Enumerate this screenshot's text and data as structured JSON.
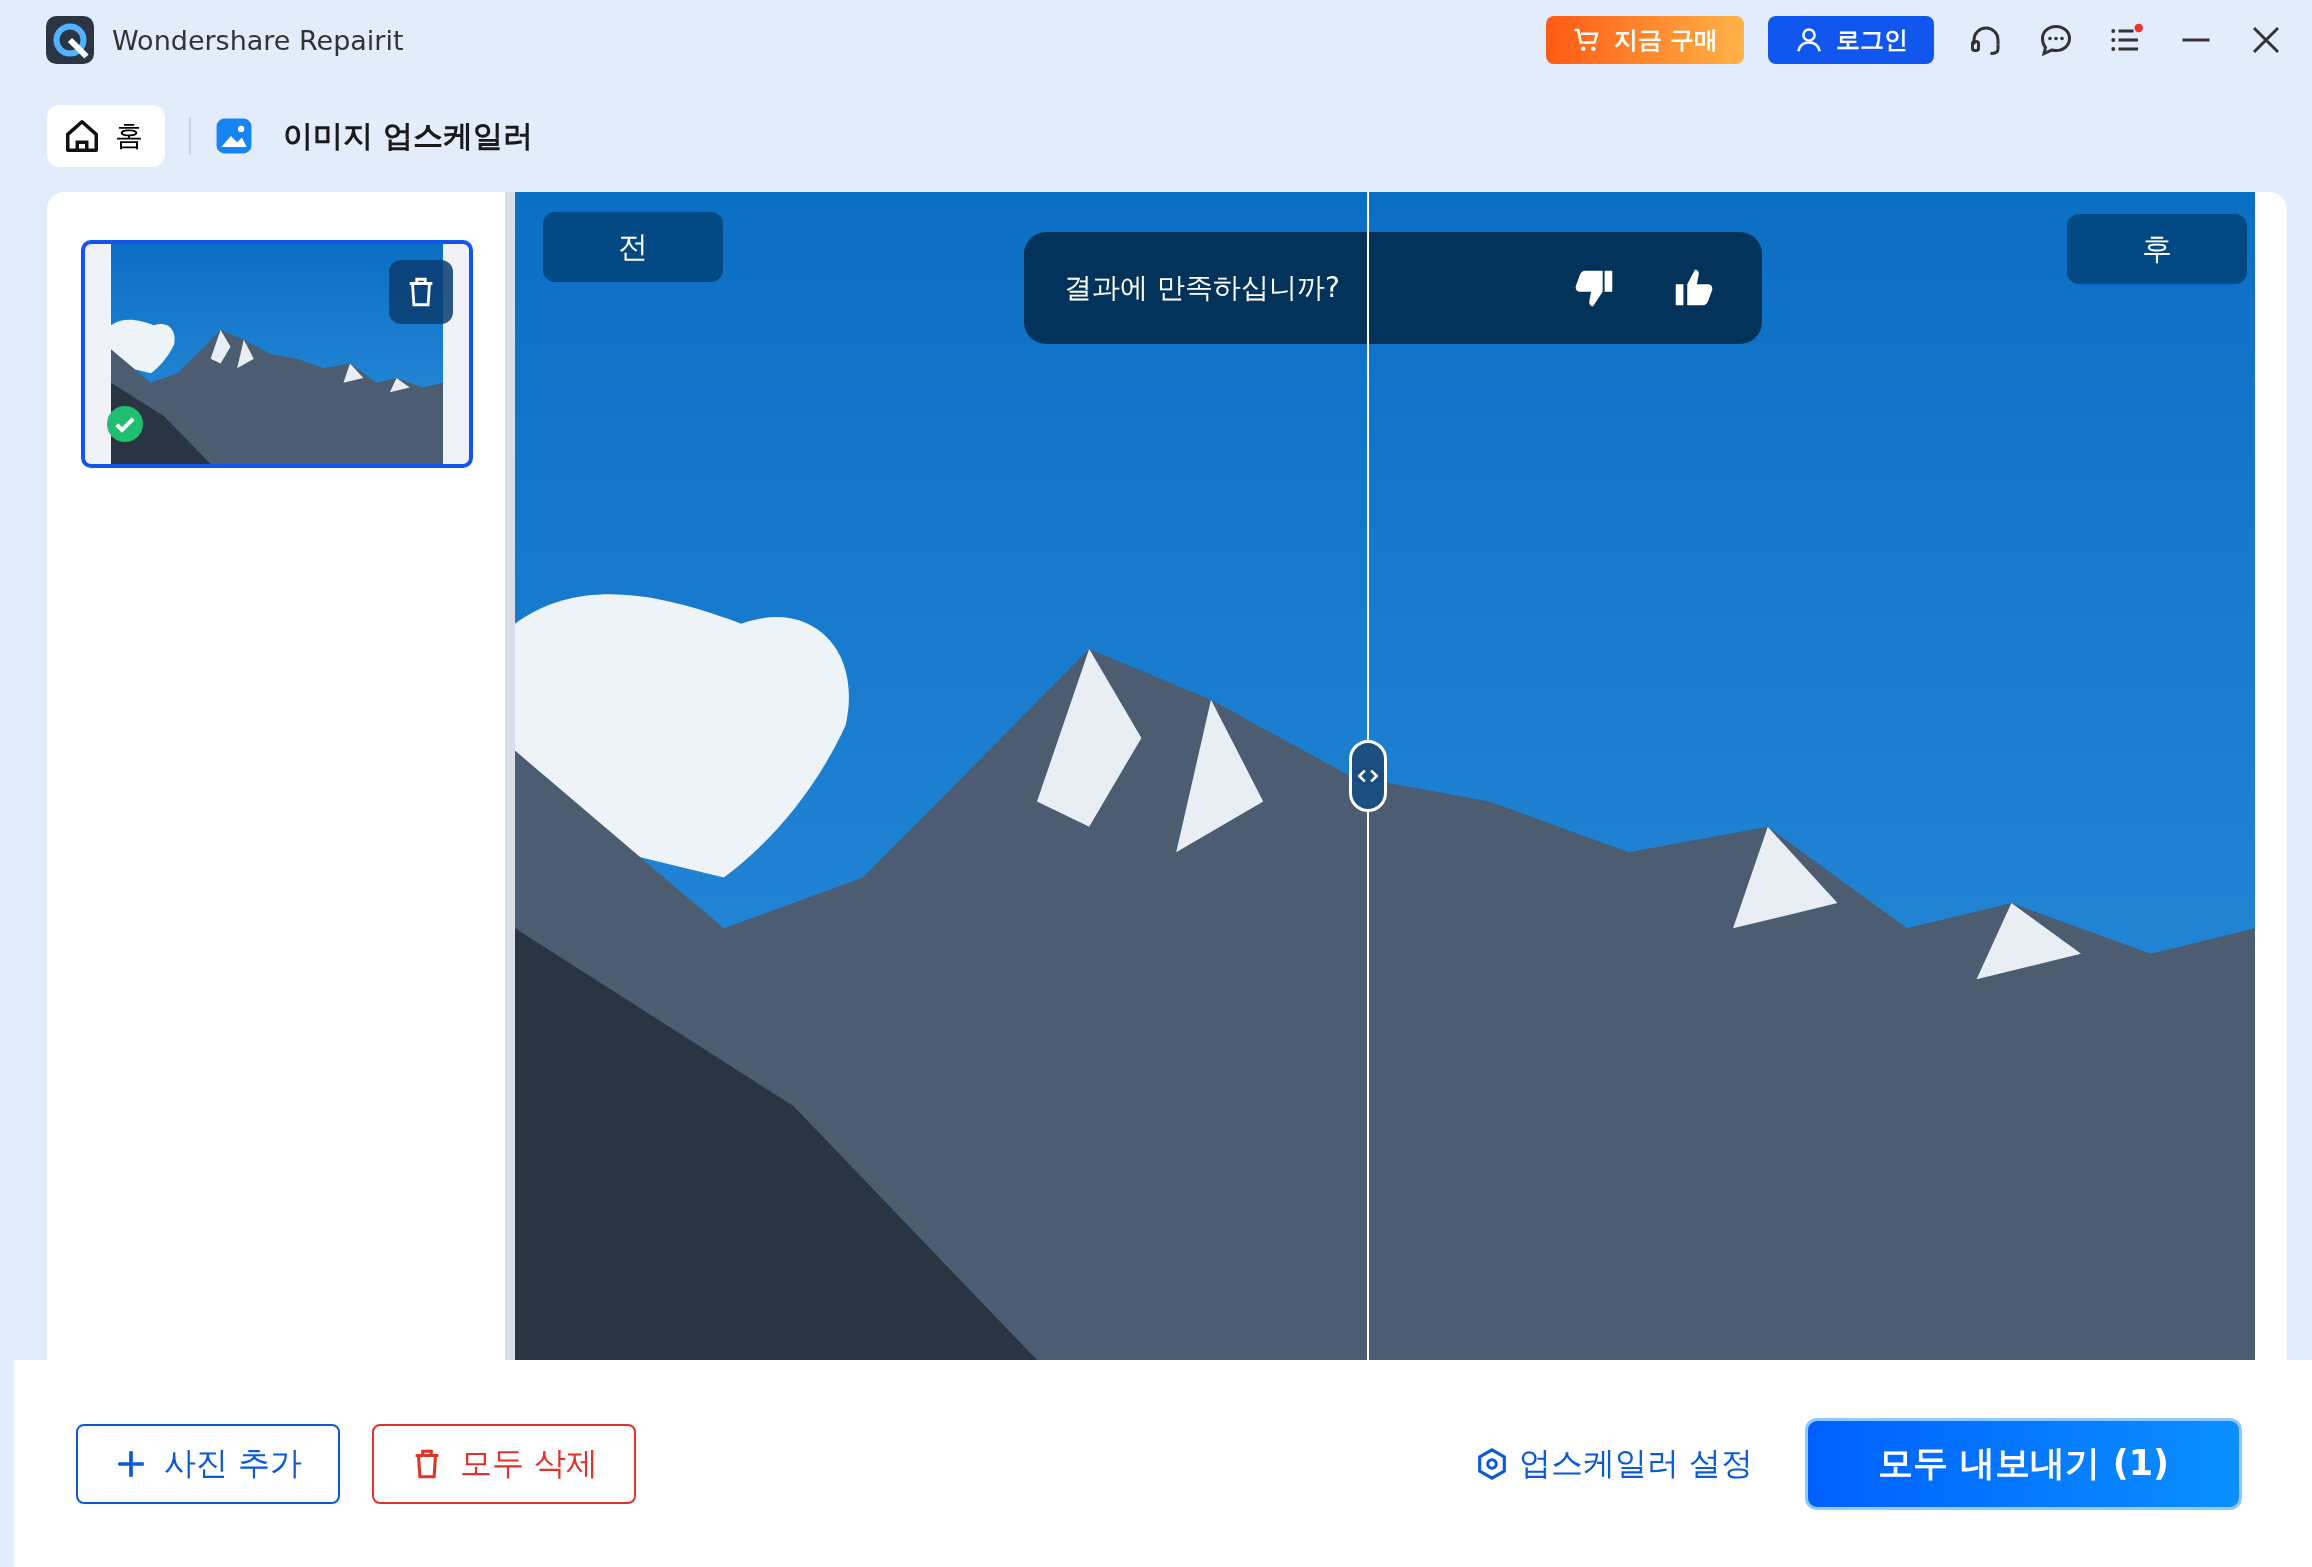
{
  "window": {
    "title": "Wondershare Repairit"
  },
  "header_buttons": [
    {
      "kind": "buy",
      "label": "지금 구매"
    },
    {
      "kind": "login",
      "label": "로그인"
    }
  ],
  "menu": {
    "notification": true
  },
  "breadcrumb": [
    {
      "kind": "home",
      "label": "홈"
    },
    {
      "kind": "tool",
      "label": "이미지 업스케일러"
    }
  ],
  "thumbnails": [
    {
      "selected": true,
      "done": true
    }
  ],
  "compare": {
    "before_label": "전",
    "after_label": "후",
    "question": "결과에 만족하십니까?",
    "level": 0.49
  },
  "actions": [
    {
      "kind": "add",
      "label": "사진 추가"
    },
    {
      "kind": "delete",
      "label": "모두 삭제"
    }
  ],
  "settings_link": "업스케일러 설정",
  "export_button": "모두 내보내기 (1)"
}
